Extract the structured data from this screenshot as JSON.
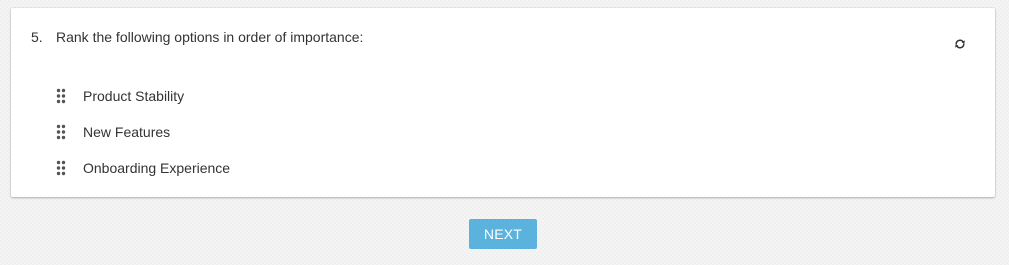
{
  "question": {
    "number": "5.",
    "text": "Rank the following options in order of importance:",
    "reset_icon": "refresh-icon",
    "options": [
      {
        "label": "Product Stability",
        "icon": "drag-handle-icon"
      },
      {
        "label": "New Features",
        "icon": "drag-handle-icon"
      },
      {
        "label": "Onboarding Experience",
        "icon": "drag-handle-icon"
      }
    ]
  },
  "footer": {
    "next_label": "NEXT"
  },
  "colors": {
    "accent": "#5bb3dd",
    "text": "#333333",
    "handle": "#555555",
    "card": "#ffffff",
    "background": "#efefef"
  }
}
